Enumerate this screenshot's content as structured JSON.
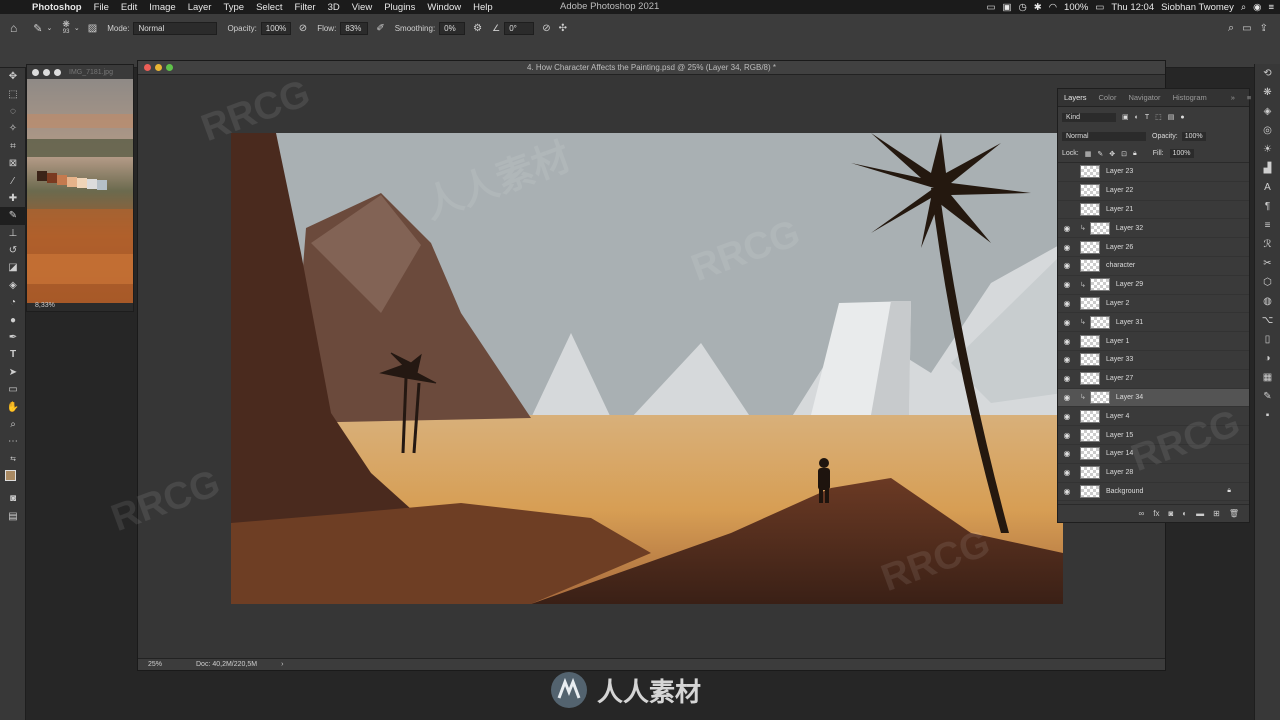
{
  "menubar": {
    "app": "Photoshop",
    "items": [
      "File",
      "Edit",
      "Image",
      "Layer",
      "Type",
      "Select",
      "Filter",
      "3D",
      "View",
      "Plugins",
      "Window",
      "Help"
    ],
    "window_title": "Adobe Photoshop 2021",
    "battery": "100%",
    "time": "Thu 12:04",
    "user": "Siobhan Twomey"
  },
  "options": {
    "brush_size": "93",
    "mode_label": "Mode:",
    "mode_value": "Normal",
    "opacity_label": "Opacity:",
    "opacity_value": "100%",
    "flow_label": "Flow:",
    "flow_value": "83%",
    "smoothing_label": "Smoothing:",
    "smoothing_value": "0%",
    "angle_value": "0°"
  },
  "reference_window": {
    "title": "IMG_7181.jpg",
    "zoom": "8,33%"
  },
  "document": {
    "title": "4. How Character Affects the Painting.psd @ 25% (Layer 34, RGB/8) *",
    "zoom": "25%",
    "doc_size": "Doc: 40,2M/220,5M"
  },
  "layers_panel": {
    "tabs": [
      "Layers",
      "Color",
      "Navigator",
      "Histogram"
    ],
    "filter_kind": "Kind",
    "blend_mode": "Normal",
    "opacity_label": "Opacity:",
    "opacity_value": "100%",
    "lock_label": "Lock:",
    "fill_label": "Fill:",
    "fill_value": "100%",
    "layers": [
      {
        "name": "Layer 23",
        "visible": false,
        "clipped": false,
        "selected": false
      },
      {
        "name": "Layer 22",
        "visible": false,
        "clipped": false,
        "selected": false
      },
      {
        "name": "Layer 21",
        "visible": false,
        "clipped": false,
        "selected": false
      },
      {
        "name": "Layer 32",
        "visible": true,
        "clipped": true,
        "selected": false
      },
      {
        "name": "Layer 26",
        "visible": true,
        "clipped": false,
        "selected": false
      },
      {
        "name": "character",
        "visible": true,
        "clipped": false,
        "selected": false
      },
      {
        "name": "Layer 29",
        "visible": true,
        "clipped": true,
        "selected": false
      },
      {
        "name": "Layer 2",
        "visible": true,
        "clipped": false,
        "selected": false
      },
      {
        "name": "Layer 31",
        "visible": true,
        "clipped": true,
        "selected": false
      },
      {
        "name": "Layer 1",
        "visible": true,
        "clipped": false,
        "selected": false
      },
      {
        "name": "Layer 33",
        "visible": true,
        "clipped": false,
        "selected": false
      },
      {
        "name": "Layer 27",
        "visible": true,
        "clipped": false,
        "selected": false
      },
      {
        "name": "Layer 34",
        "visible": true,
        "clipped": true,
        "selected": true
      },
      {
        "name": "Layer 4",
        "visible": true,
        "clipped": false,
        "selected": false
      },
      {
        "name": "Layer 15",
        "visible": true,
        "clipped": false,
        "selected": false
      },
      {
        "name": "Layer 14",
        "visible": true,
        "clipped": false,
        "selected": false
      },
      {
        "name": "Layer 28",
        "visible": true,
        "clipped": false,
        "selected": false
      },
      {
        "name": "Background",
        "visible": true,
        "clipped": false,
        "selected": false
      }
    ]
  },
  "watermark": {
    "latin": "RRCG",
    "cjk": "人人素材"
  },
  "colors": {
    "sky": "#a9b0b3",
    "sand": "#d9a65c",
    "cliff": "#4a2a1e"
  }
}
